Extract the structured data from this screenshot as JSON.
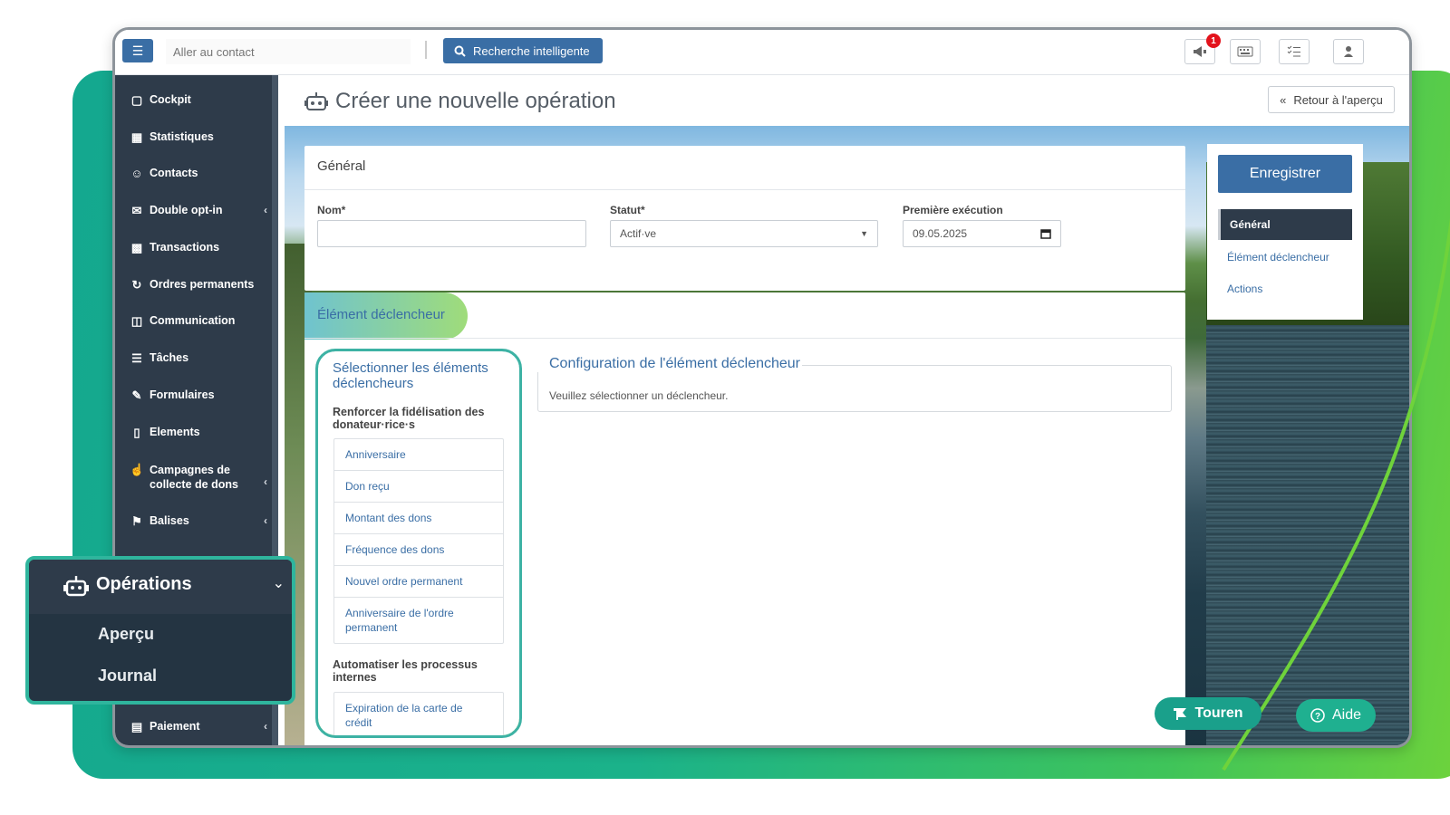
{
  "topbar": {
    "menu_icon": "hamburger-icon",
    "contact_placeholder": "Aller au contact",
    "search_button": "Recherche intelligente",
    "notification_count": "1",
    "icons": [
      "megaphone-icon",
      "keyboard-icon",
      "checklist-icon",
      "user-icon"
    ]
  },
  "sidebar": {
    "items": [
      {
        "label": "Cockpit",
        "icon": "laptop-icon"
      },
      {
        "label": "Statistiques",
        "icon": "chart-icon"
      },
      {
        "label": "Contacts",
        "icon": "users-icon"
      },
      {
        "label": "Double opt-in",
        "icon": "envelope-icon"
      },
      {
        "label": "Transactions",
        "icon": "money-icon"
      },
      {
        "label": "Ordres permanents",
        "icon": "recurring-icon"
      },
      {
        "label": "Communication",
        "icon": "chat-icon"
      },
      {
        "label": "Tâches",
        "icon": "tasks-icon"
      },
      {
        "label": "Formulaires",
        "icon": "edit-icon"
      },
      {
        "label": "Elements",
        "icon": "puzzle-icon"
      },
      {
        "label": "Campagnes de collecte de dons",
        "icon": "thumbs-up-icon"
      },
      {
        "label": "Balises",
        "icon": "tag-icon"
      },
      {
        "label": "Paiement",
        "icon": "card-icon"
      }
    ]
  },
  "header": {
    "title": "Créer une nouvelle opération",
    "back_button": "Retour à l'aperçu"
  },
  "general": {
    "title": "Général",
    "name_label": "Nom*",
    "name_value": "",
    "status_label": "Statut*",
    "status_value": "Actif·ve",
    "first_exec_label": "Première exécution",
    "first_exec_value": "09.05.2025"
  },
  "trigger": {
    "title": "Élément déclencheur",
    "select_title": "Sélectionner les éléments déclencheurs",
    "group1": "Renforcer la fidélisation des donateur·rice·s",
    "group1_items": [
      "Anniversaire",
      "Don reçu",
      "Montant des dons",
      "Fréquence des dons",
      "Nouvel ordre permanent",
      "Anniversaire de l'ordre permanent"
    ],
    "group2": "Automatiser les processus internes",
    "group2_items": [
      "Expiration de la carte de crédit"
    ],
    "config_title": "Configuration de l'élément déclencheur",
    "config_text": "Veuillez sélectionner un déclencheur."
  },
  "right_panel": {
    "save_button": "Enregistrer",
    "nav": [
      "Général",
      "Élément déclencheur",
      "Actions"
    ]
  },
  "floating": {
    "touren": "Touren",
    "aide": "Aide"
  },
  "operations_callout": {
    "title": "Opérations",
    "items": [
      "Aperçu",
      "Journal"
    ]
  },
  "colors": {
    "primary": "#3a6ea5",
    "sidebar": "#2e3b4a",
    "accent_green": "#1aa08b",
    "badge_red": "#e3131c"
  }
}
